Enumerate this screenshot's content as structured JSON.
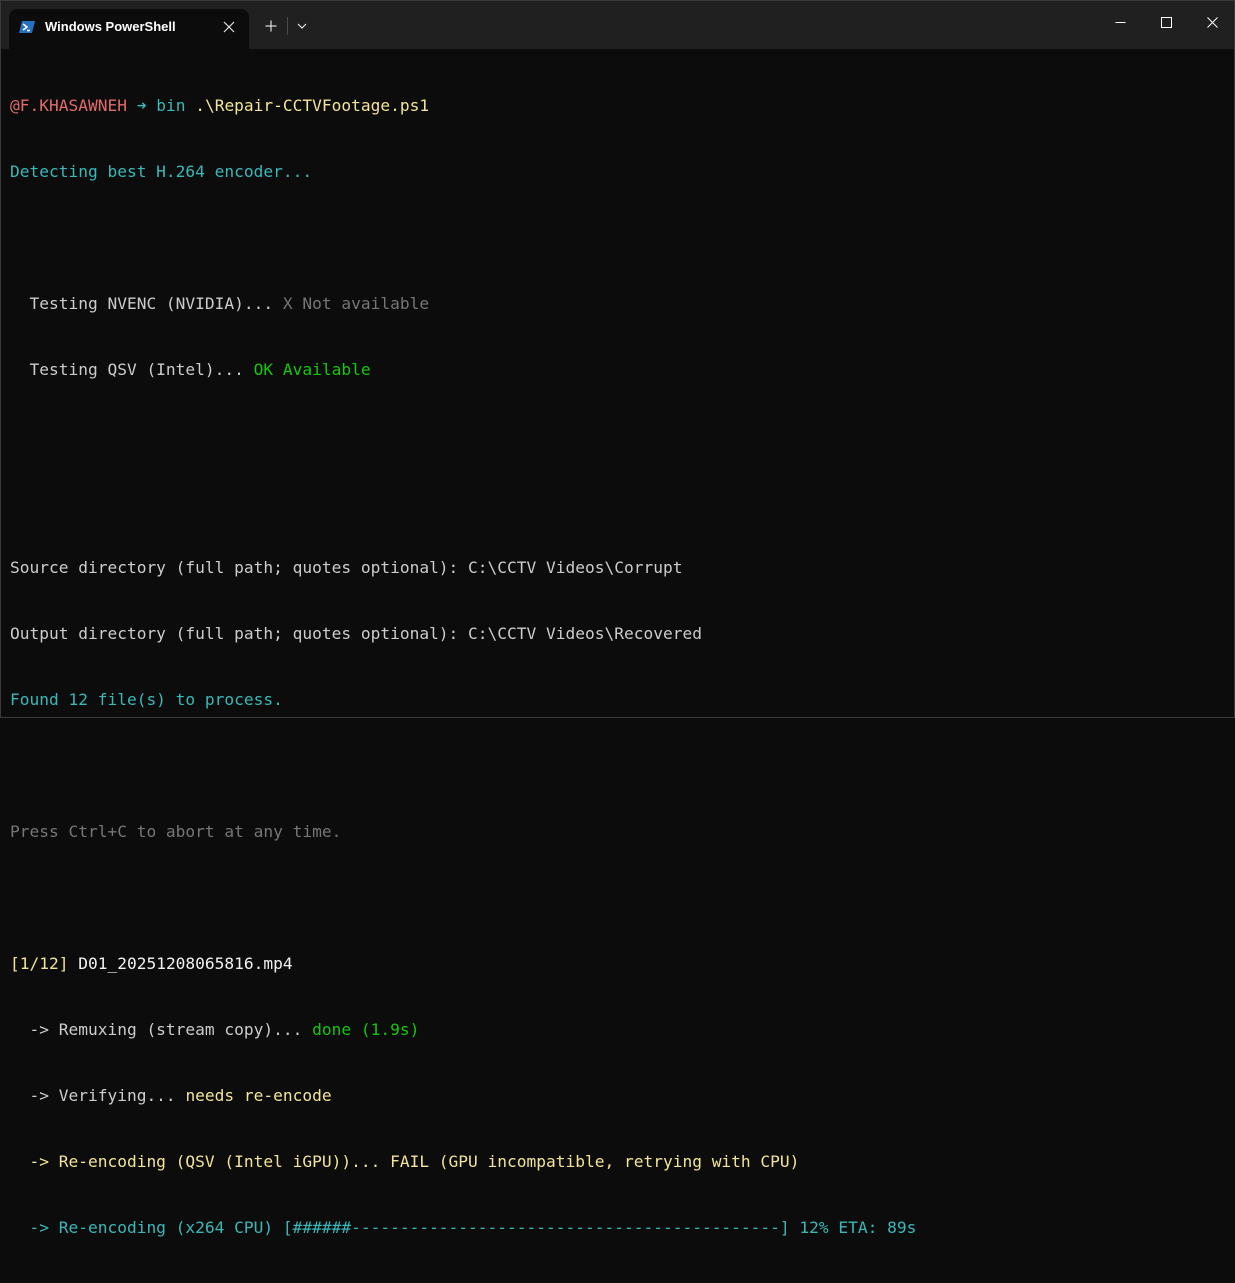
{
  "window": {
    "tab_title": "Windows PowerShell",
    "new_tab_label": "+",
    "dropdown_icon": "chevron-down-icon",
    "tab_icon": "powershell-icon"
  },
  "colors": {
    "background": "#0c0c0c",
    "titlebar": "#202020",
    "prompt_user": "#e06c6c",
    "cyan": "#3ab8b8",
    "green": "#16c60c",
    "gray": "#767676",
    "yellow": "#f2e49a"
  },
  "terminal": {
    "prompt_user": "@F.KHASAWNEH",
    "prompt_arrow": "➜",
    "prompt_dir": "bin",
    "prompt_command": ".\\Repair-CCTVFootage.ps1",
    "detecting": "Detecting best H.264 encoder...",
    "nvenc_label": "  Testing NVENC (NVIDIA)... ",
    "nvenc_status": "X Not available",
    "qsv_label": "  Testing QSV (Intel)... ",
    "qsv_status": "OK Available",
    "source_dir": "Source directory (full path; quotes optional): C:\\CCTV Videos\\Corrupt",
    "output_dir": "Output directory (full path; quotes optional): C:\\CCTV Videos\\Recovered",
    "found_files": "Found 12 file(s) to process.",
    "abort_hint": "Press Ctrl+C to abort at any time.",
    "file_index": "[1/12]",
    "file_name": " D01_20251208065816.mp4",
    "remux_label": "  -> Remuxing (stream copy)... ",
    "remux_status": "done (1.9s)",
    "verify_label": "  -> Verifying... ",
    "verify_status": "needs re-encode",
    "reencode_qsv": "  -> Re-encoding (QSV (Intel iGPU))... FAIL (GPU incompatible, retrying with CPU)",
    "reencode_cpu": "  -> Re-encoding (x264 CPU) [######--------------------------------------------] 12% ETA: 89s"
  },
  "progress": {
    "percent": 12,
    "eta_seconds": 89
  }
}
